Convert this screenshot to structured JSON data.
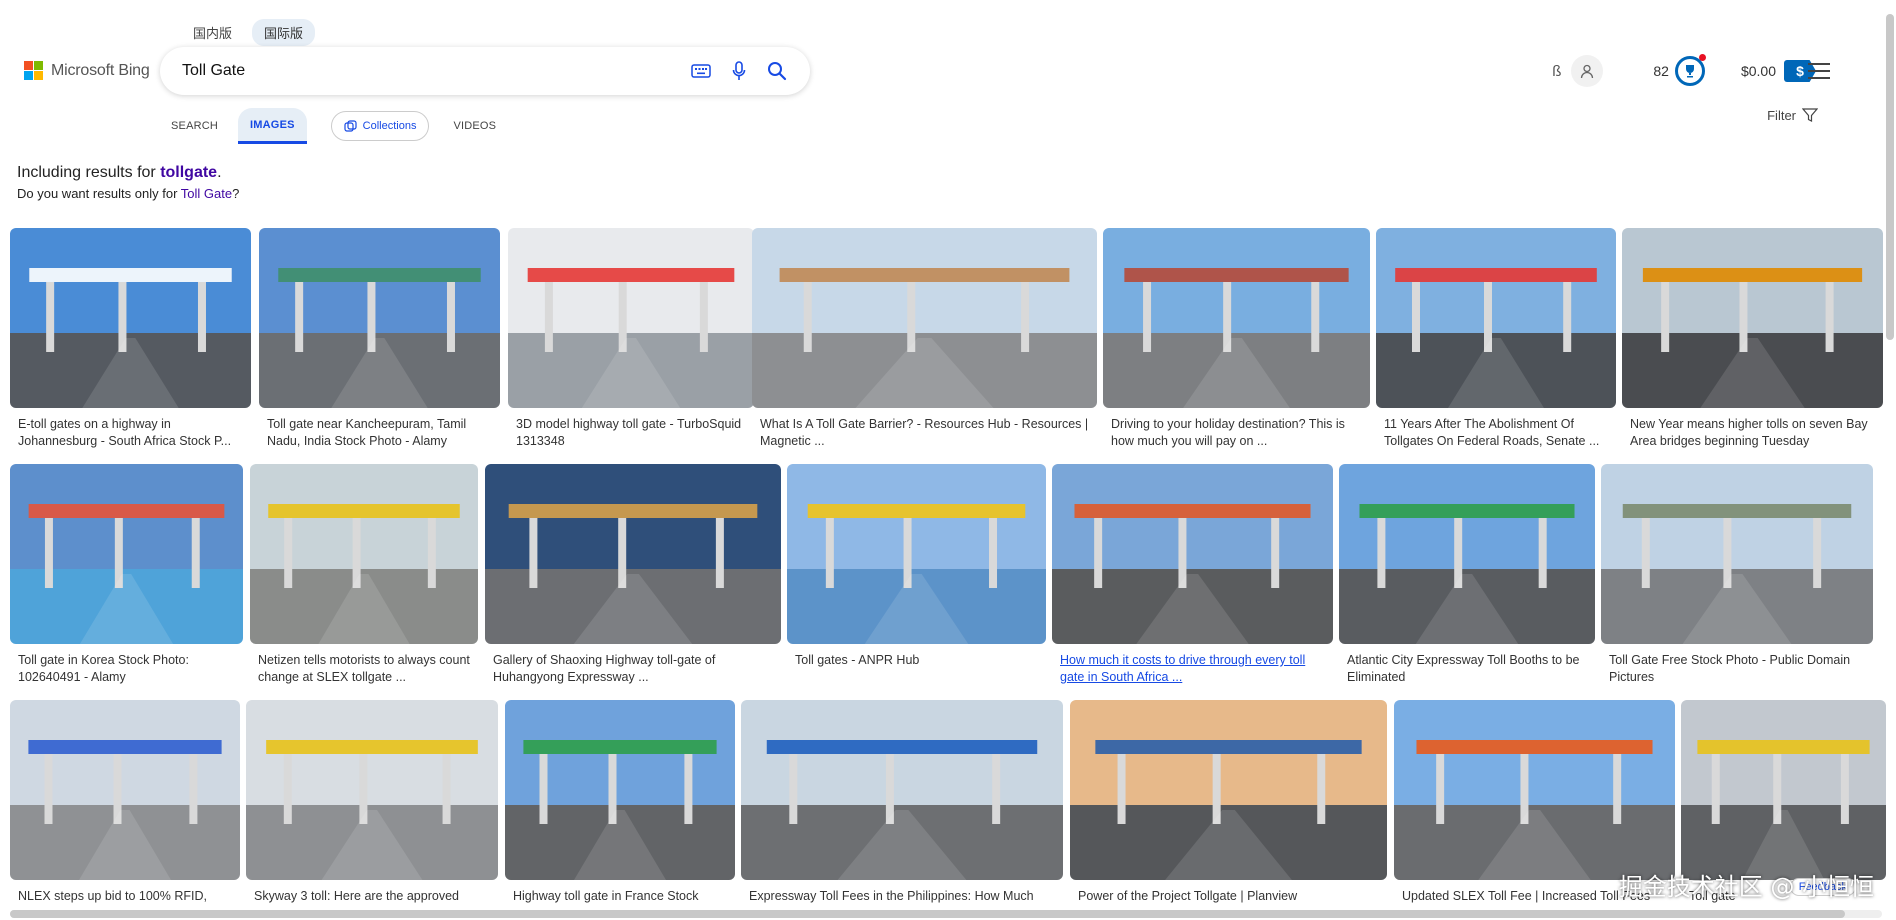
{
  "region_tabs": [
    "国内版",
    "国际版"
  ],
  "logo": {
    "text": "Microsoft Bing"
  },
  "search": {
    "value": "Toll Gate",
    "placeholder": ""
  },
  "header": {
    "icon_char": "ß",
    "points": "82",
    "money": "$0.00",
    "money_symbol": "$"
  },
  "nav": {
    "items": [
      "SEARCH",
      "IMAGES",
      "Collections",
      "VIDEOS"
    ],
    "active": "IMAGES",
    "filter_label": "Filter"
  },
  "notice": {
    "line1_prefix": "Including results for ",
    "line1_term": "tollgate",
    "line1_suffix": ".",
    "line2_prefix": "Do you want results only for ",
    "line2_term": "Toll Gate",
    "line2_suffix": "?"
  },
  "results": {
    "row1": [
      {
        "caption": "E-toll gates on a highway in Johannesburg - South Africa Stock P...",
        "sky": "#4a8cd6",
        "ground": "#555a61",
        "accent": "#ffffff"
      },
      {
        "caption": "Toll gate near Kancheepuram, Tamil Nadu, India Stock Photo - Alamy",
        "sky": "#5b8fd1",
        "ground": "#6b6f74",
        "accent": "#3f8f6a"
      },
      {
        "caption": "3D model highway toll gate - TurboSquid 1313348",
        "sky": "#e8eaed",
        "ground": "#9aa0a6",
        "accent": "#e53935"
      },
      {
        "caption": "What Is A Toll Gate Barrier? - Resources Hub - Resources | Magnetic ...",
        "sky": "#c7d8e8",
        "ground": "#8d8f92",
        "accent": "#c08a55"
      },
      {
        "caption": "Driving to your holiday destination? This is how much you will pay on ...",
        "sky": "#79aee0",
        "ground": "#7d7f82",
        "accent": "#b54a3a"
      },
      {
        "caption": "11 Years After The Abolishment Of Tollgates On Federal Roads, Senate ...",
        "sky": "#7fb0e0",
        "ground": "#4d5258",
        "accent": "#e53935"
      },
      {
        "caption": "New Year means higher tolls on seven Bay Area bridges beginning Tuesday",
        "sky": "#b9c7d2",
        "ground": "#4a4c50",
        "accent": "#e08a00"
      }
    ],
    "row2": [
      {
        "caption": "Toll gate in Korea Stock Photo: 102640491 - Alamy",
        "sky": "#5d8fcc",
        "ground": "#4fa3d9",
        "accent": "#e5533a"
      },
      {
        "caption": "Netizen tells motorists to always count change at SLEX tollgate ...",
        "sky": "#c8d3d8",
        "ground": "#8a8c8a",
        "accent": "#e8c21a"
      },
      {
        "caption": "Gallery of Shaoxing Highway toll-gate of Huhangyong Expressway ...",
        "sky": "#2f4f7a",
        "ground": "#6c6e72",
        "accent": "#d6a04a"
      },
      {
        "caption": "Toll gates - ANPR Hub",
        "sky": "#8fb8e6",
        "ground": "#5c93c9",
        "accent": "#f0c419"
      },
      {
        "caption": "How much it costs to drive through every toll gate in South Africa ...",
        "sky": "#7aa6d8",
        "ground": "#5a5c5e",
        "accent": "#e05a2a"
      },
      {
        "caption": "Atlantic City Expressway Toll Booths to be Eliminated",
        "sky": "#6ea4de",
        "ground": "#595c60",
        "accent": "#2e9f4a"
      },
      {
        "caption": "Toll Gate Free Stock Photo - Public Domain Pictures",
        "sky": "#bfd2e4",
        "ground": "#7e8185",
        "accent": "#7b8b6f"
      }
    ],
    "row3": [
      {
        "caption": "NLEX steps up bid to 100% RFID,",
        "sky": "#cfd8e2",
        "ground": "#8f9194",
        "accent": "#2f5fd0"
      },
      {
        "caption": "Skyway 3 toll: Here are the approved",
        "sky": "#d8dde2",
        "ground": "#8e9093",
        "accent": "#e8c21a"
      },
      {
        "caption": "Highway toll gate in France Stock",
        "sky": "#6fa2dc",
        "ground": "#626467",
        "accent": "#2e9f4a"
      },
      {
        "caption": "Expressway Toll Fees in the Philippines: How Much",
        "sky": "#c9d6e1",
        "ground": "#6d6f72",
        "accent": "#1e5fbf"
      },
      {
        "caption": "Power of the Project Tollgate | Planview",
        "sky": "#e7b98a",
        "ground": "#55575a",
        "accent": "#2a5fa8"
      },
      {
        "caption": "Updated SLEX Toll Fee | Increased Toll Fees",
        "sky": "#7aaee4",
        "ground": "#6a6c6f",
        "accent": "#e85b1c"
      },
      {
        "caption": "Toll gate",
        "sky": "#c2c8cf",
        "ground": "#5f6164",
        "accent": "#e8c21a"
      }
    ]
  },
  "watermark": "掘金技术社区 @ 小恒恒",
  "feedback": "Feedback",
  "colors": {
    "brand_blue": "#174ae4",
    "visited_purple": "#4007a2",
    "rewards_blue": "#0067b8"
  }
}
